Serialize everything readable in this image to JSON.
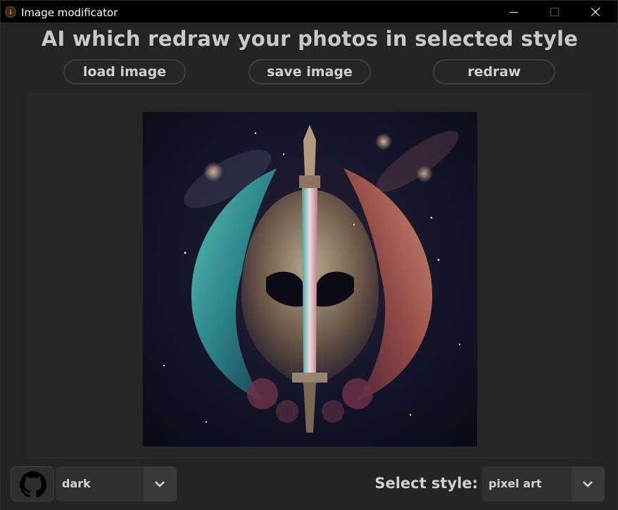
{
  "window": {
    "title": "Image modificator",
    "icon": "app-icon",
    "controls": [
      "minimize-icon",
      "maximize-icon",
      "close-icon"
    ]
  },
  "header": {
    "heading": "AI which redraw your photos in selected style"
  },
  "toolbar": {
    "load_label": "load image",
    "save_label": "save image",
    "redraw_label": "redraw"
  },
  "preview": {
    "image_icon": "pixel-art-sword-helmet-image"
  },
  "footer": {
    "github_icon": "github-icon",
    "theme_value": "dark",
    "style_label": "Select style:",
    "style_value": "pixel art"
  },
  "colors": {
    "background": "#242424",
    "titlebar": "#000000",
    "button_border": "#3c3c3c",
    "text": "#d0d0d0",
    "combo": "#303030",
    "combo_arrow_bg": "#3a3a3a"
  }
}
